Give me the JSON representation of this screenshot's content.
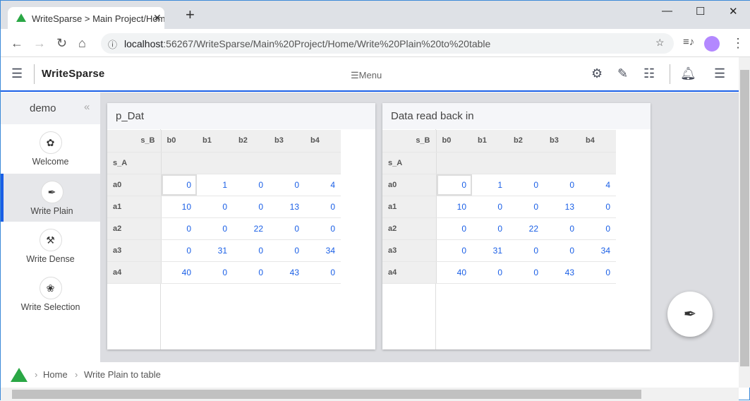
{
  "browser": {
    "tab_title": "WriteSparse > Main Project/Home",
    "url_host": "localhost",
    "url_path": ":56267/WriteSparse/Main%20Project/Home/Write%20Plain%20to%20table"
  },
  "app": {
    "brand": "WriteSparse",
    "menu_label": "Menu"
  },
  "sidebar": {
    "title": "demo",
    "items": [
      {
        "label": "Welcome",
        "icon": "flower-icon"
      },
      {
        "label": "Write Plain",
        "icon": "pen-nib-icon",
        "active": true
      },
      {
        "label": "Write Dense",
        "icon": "hammer-icon"
      },
      {
        "label": "Write Selection",
        "icon": "flower-outline-icon"
      }
    ]
  },
  "tables": [
    {
      "title": "p_Dat",
      "col_dim": "s_B",
      "row_dim": "s_A",
      "columns": [
        "b0",
        "b1",
        "b2",
        "b3",
        "b4"
      ],
      "rows": [
        {
          "label": "a0",
          "values": [
            "0",
            "1",
            "0",
            "0",
            "4"
          ]
        },
        {
          "label": "a1",
          "values": [
            "10",
            "0",
            "0",
            "13",
            "0"
          ]
        },
        {
          "label": "a2",
          "values": [
            "0",
            "0",
            "22",
            "0",
            "0"
          ]
        },
        {
          "label": "a3",
          "values": [
            "0",
            "31",
            "0",
            "0",
            "34"
          ]
        },
        {
          "label": "a4",
          "values": [
            "40",
            "0",
            "0",
            "43",
            "0"
          ]
        }
      ]
    },
    {
      "title": "Data read back in",
      "col_dim": "s_B",
      "row_dim": "s_A",
      "columns": [
        "b0",
        "b1",
        "b2",
        "b3",
        "b4"
      ],
      "rows": [
        {
          "label": "a0",
          "values": [
            "0",
            "1",
            "0",
            "0",
            "4"
          ]
        },
        {
          "label": "a1",
          "values": [
            "10",
            "0",
            "0",
            "13",
            "0"
          ]
        },
        {
          "label": "a2",
          "values": [
            "0",
            "0",
            "22",
            "0",
            "0"
          ]
        },
        {
          "label": "a3",
          "values": [
            "0",
            "31",
            "0",
            "0",
            "34"
          ]
        },
        {
          "label": "a4",
          "values": [
            "40",
            "0",
            "0",
            "43",
            "0"
          ]
        }
      ]
    }
  ],
  "breadcrumb": [
    "Home",
    "Write Plain to table"
  ],
  "colors": {
    "accent": "#1a5fe6",
    "value": "#1a5fe6"
  }
}
